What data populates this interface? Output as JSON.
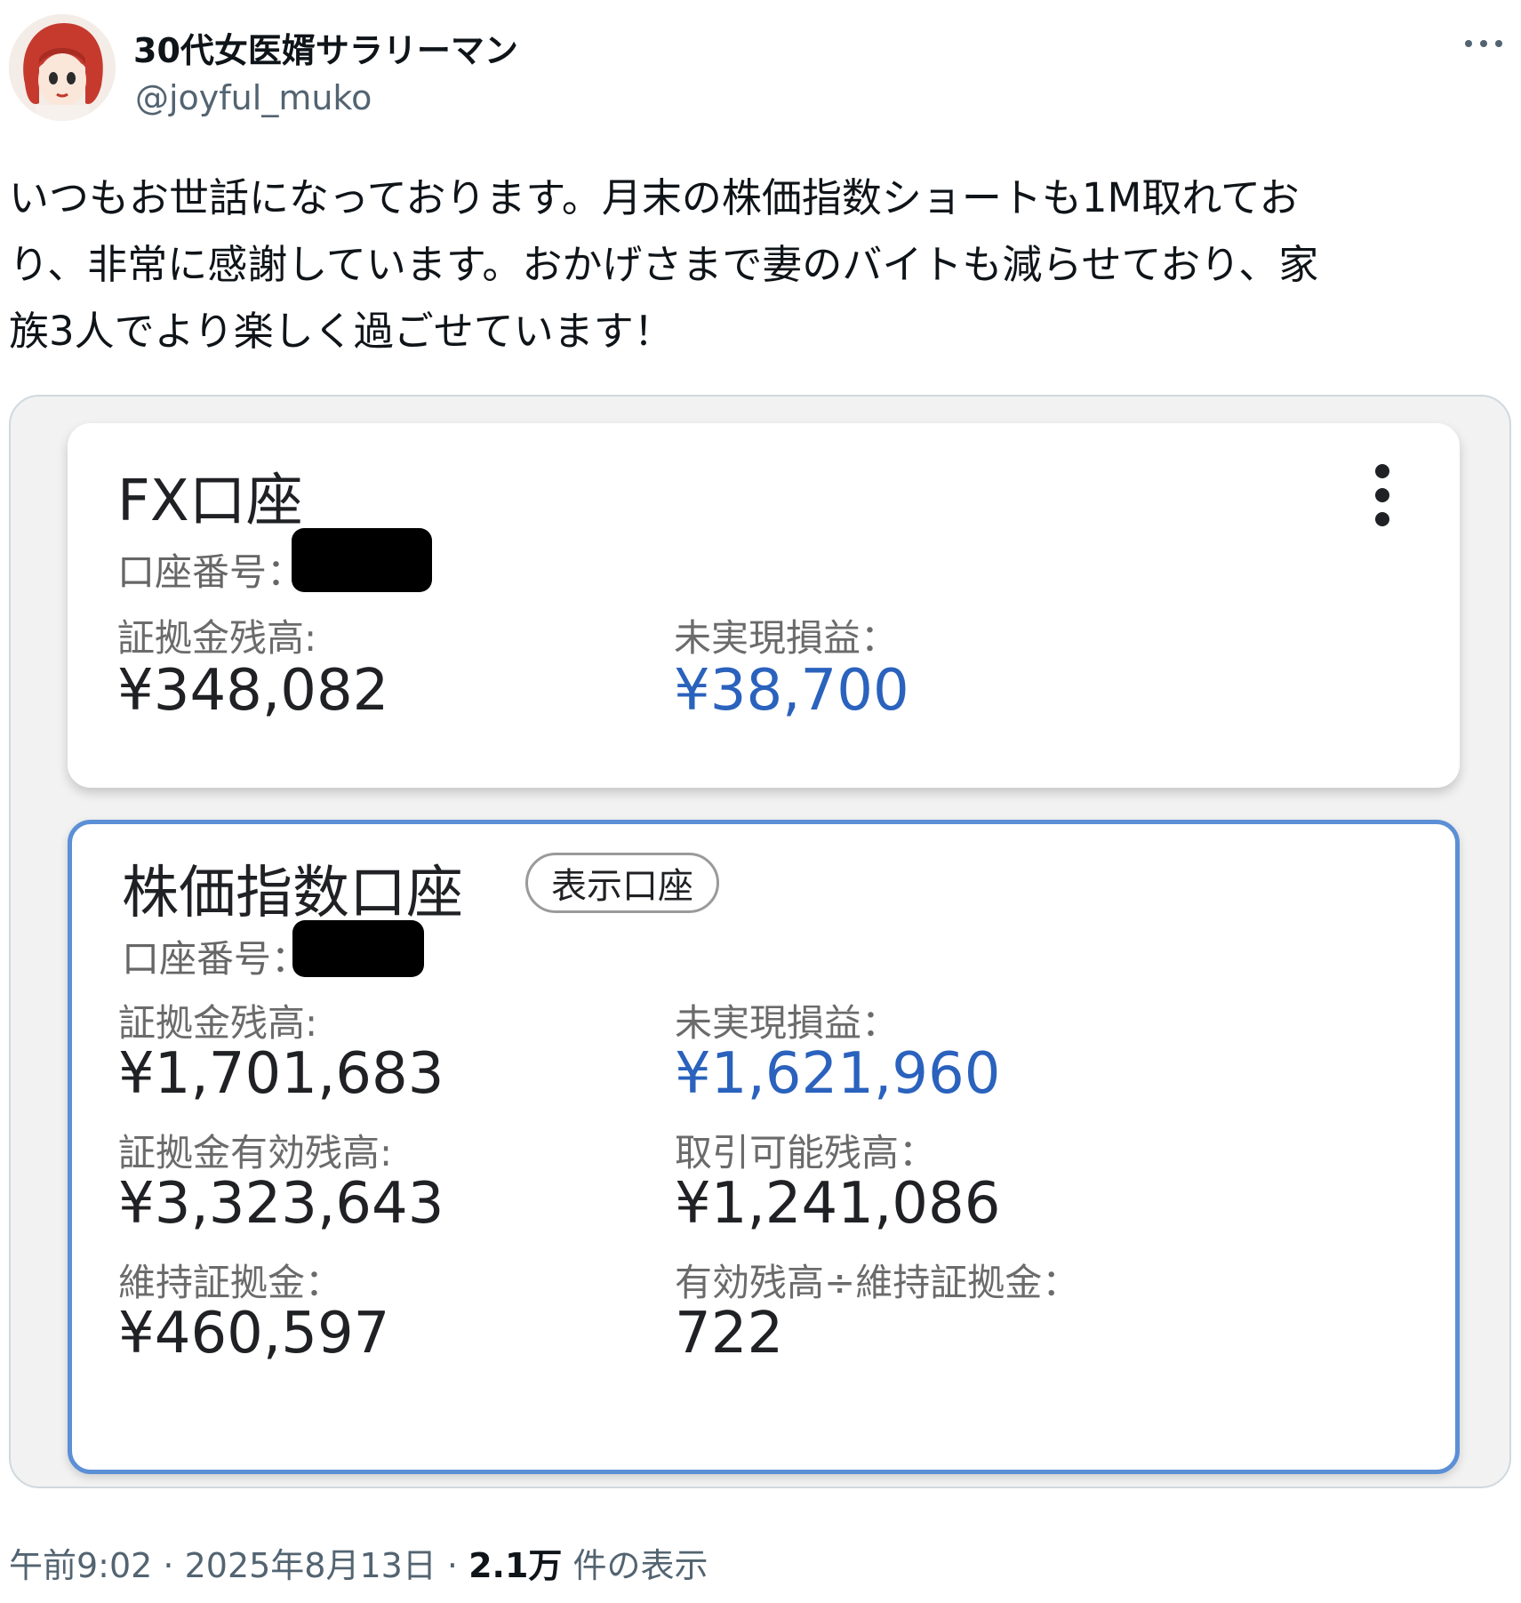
{
  "user": {
    "display_name": "30代女医婿サラリーマン",
    "handle": "@joyful_muko"
  },
  "tweet": {
    "lines": [
      "いつもお世話になっております。月末の株価指数ショートも1M取れてお",
      "り、非常に感謝しています。おかげさまで妻のバイトも減らせており、家",
      "族3人でより楽しく過ごせています！"
    ]
  },
  "fx_account": {
    "title": "FX口座",
    "account_label": "口座番号：",
    "margin_balance_label": "証拠金残高:",
    "margin_balance": "¥348,082",
    "unrealized_label": "未実現損益：",
    "unrealized": "¥38,700"
  },
  "index_account": {
    "title": "株価指数口座",
    "badge": "表示口座",
    "account_label": "口座番号：",
    "margin_balance_label": "証拠金残高:",
    "margin_balance": "¥1,701,683",
    "unrealized_label": "未実現損益：",
    "unrealized": "¥1,621,960",
    "effective_margin_label": "証拠金有効残高:",
    "effective_margin": "¥3,323,643",
    "tradable_label": "取引可能残高：",
    "tradable": "¥1,241,086",
    "maintenance_label": "維持証拠金：",
    "maintenance": "¥460,597",
    "ratio_label": "有効残高÷維持証拠金：",
    "ratio": "722"
  },
  "meta": {
    "time": "午前9:02",
    "date": "2025年8月13日",
    "views_count": "2.1万",
    "views_label": "件の表示"
  },
  "colors": {
    "accent_blue": "#2a62bd",
    "selected_border": "#5b8fd6"
  }
}
